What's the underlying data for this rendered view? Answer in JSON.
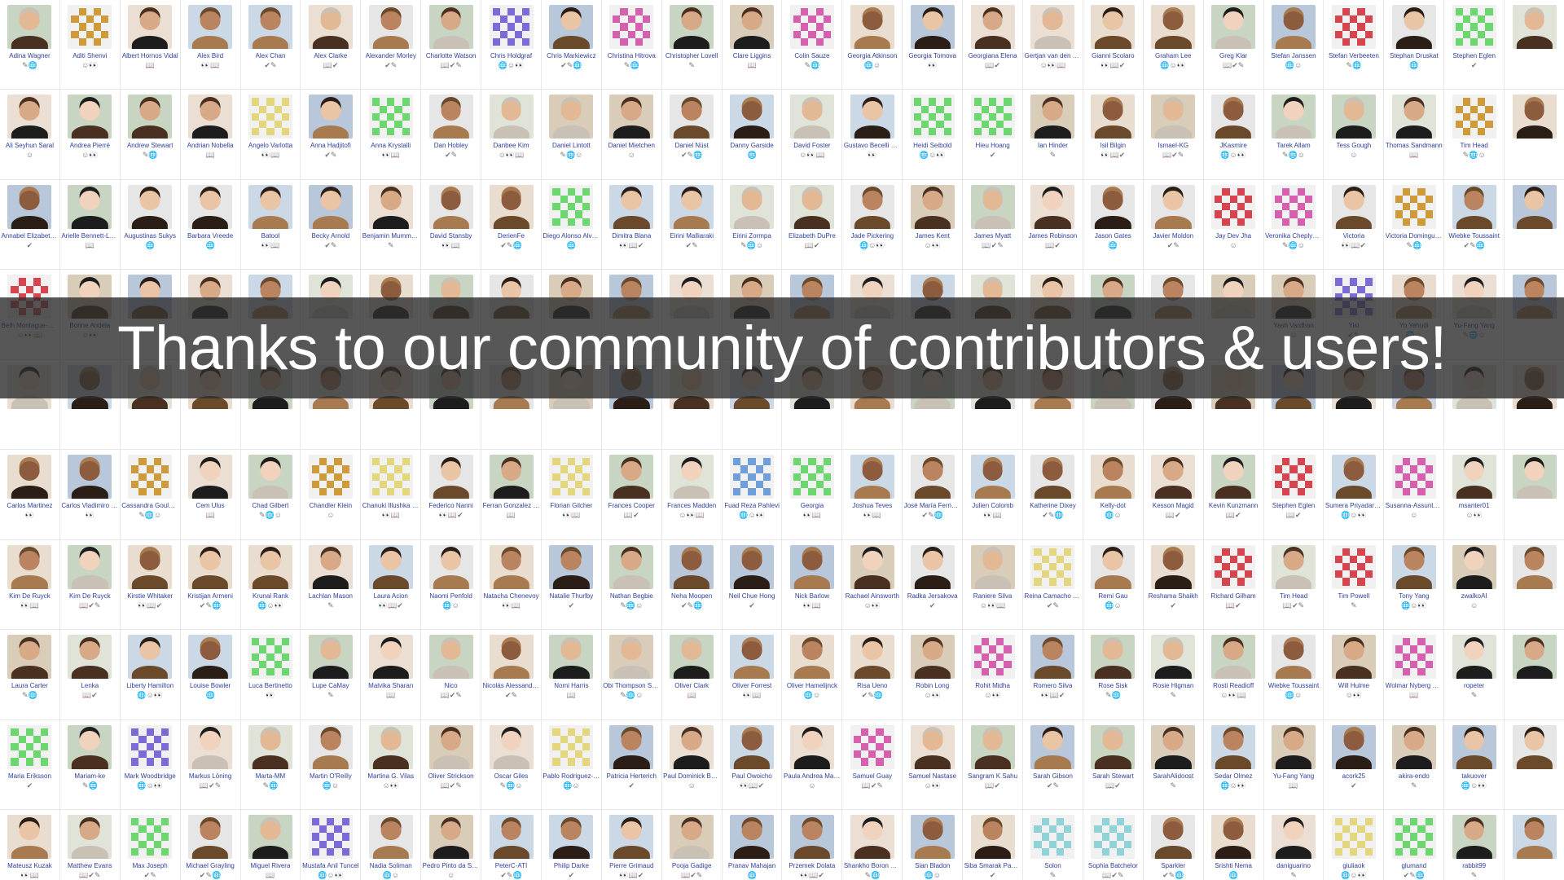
{
  "banner": {
    "text": "Thanks to our community of contributors & users!"
  },
  "colors": {
    "banner_overlay": "#2d2d2d",
    "banner_text": "#ffffff",
    "name_text": "#2f3f99",
    "identicon_palette": [
      "#7d6ad6",
      "#d65fb0",
      "#6cd66f",
      "#cf9b3a",
      "#6f9fdb",
      "#d6454e",
      "#e4d67d",
      "#8fd3d9"
    ]
  },
  "badge_icons": [
    "pencil-icon",
    "globe-icon",
    "smiley-icon",
    "eyes-icon",
    "book-icon",
    "check-icon"
  ],
  "contributors": [
    "Adina Wagner",
    "Aditi Shenvi",
    "Albert Hornos Vidal",
    "Alex Bird",
    "Alex Chan",
    "Alex Clarke",
    "Alexander Morley",
    "Charlotte Watson",
    "Chris Holdgraf",
    "Chris Markiewicz",
    "Christina Hitrova",
    "Christopher Lovell",
    "Clare Liggins",
    "Colin Sauze",
    "Georgia Atkinson",
    "Georgia Tomova",
    "Georgiana Elena",
    "Gertjan van den Burg",
    "Gianni Scolaro",
    "Graham Lee",
    "Greg Klar",
    "Stefan Janssen",
    "Stefan Verbeeten",
    "Stephan Druskat",
    "Stephen Eglen",
    "",
    "Ali Seyhun Saral",
    "Andrea Pierré",
    "Andrew Stewart",
    "Andrian Nobella",
    "Angelo Varlotta",
    "Anna Hadjitofi",
    "Anna Krystalli",
    "Dan Hobley",
    "Danbee Kim",
    "Daniel Lintott",
    "Daniel Mietchen",
    "Daniel Nüst",
    "Danny Garside",
    "David Foster",
    "Gustavo Becelli do Nacimento",
    "Heidi Seibold",
    "Hieu Hoang",
    "Ian Hinder",
    "Isil Bilgin",
    "Ismael-KG",
    "JKasmire",
    "Tarek Allam",
    "Tess Gough",
    "Thomas Sandmann",
    "Tim Head",
    "",
    "Annabel Elizabeth Whipp",
    "Arielle Bennett-Lovell",
    "Augustinas Sukys",
    "Barbara Vreede",
    "Batool",
    "Becky Arnold",
    "Benjamin Mummery",
    "David Stansby",
    "DerienFe",
    "Diego Alonso Alvarez",
    "Dimitra Blana",
    "Eirini Malliaraki",
    "Eirini Zormpa",
    "Elizabeth DuPre",
    "Jade Pickering",
    "James Kent",
    "James Myatt",
    "James Robinson",
    "Jason Gates",
    "Javier Moldon",
    "Jay Dev Jha",
    "Veronika Cheplygina",
    "Victoria",
    "Victoria Dominguez del Angel",
    "Wiebke Toussaint",
    "",
    "Beth Montague-Hellen",
    "Bonne Andela",
    "",
    "",
    "",
    "",
    "",
    "",
    "",
    "",
    "",
    "",
    "",
    "",
    "",
    "",
    "",
    "",
    "",
    "",
    "",
    "Yash Vardhan",
    "Yixi",
    "Yo Yehudi",
    "Yu-Fang Yang",
    "",
    "",
    "",
    "",
    "",
    "",
    "",
    "",
    "",
    "",
    "",
    "",
    "",
    "",
    "",
    "",
    "",
    "",
    "",
    "",
    "",
    "",
    "",
    "",
    "",
    "",
    "",
    "Carlos Martinez",
    "Carlos Vladimiro González Zelaya",
    "Cassandra Gould van Praag",
    "Cem Ulus",
    "Chad Gilbert",
    "Chandler Klein",
    "Chanuki Illushka Seresinhe",
    "Federico Nanni",
    "Ferran Gonzalez Hernandez",
    "Florian Gilcher",
    "Frances Cooper",
    "Frances Madden",
    "Fuad Reza Pahlevi",
    "Georgia",
    "Joshua Teves",
    "José María Fernández",
    "Julien Colomb",
    "Katherine Dixey",
    "Kelly-dot",
    "Kesson Magid",
    "Kevin Kunzmann",
    "Stephen Eglen",
    "Sumera Priyadarsini",
    "Susanna-Assunta Sansone",
    "msanter01",
    "",
    "Kim De Ruyck",
    "Kim De Ruyck",
    "Kirstie Whitaker",
    "Kristijan Armeni",
    "Krunal Rank",
    "Lachlan Mason",
    "Laura Acion",
    "Naomi Penfold",
    "Natacha Chenevoy",
    "Natalie Thurlby",
    "Nathan Begbie",
    "Neha Moopen",
    "Neil Chue Hong",
    "Nick Barlow",
    "Rachael Ainsworth",
    "Radka Jersakova",
    "Raniere Silva",
    "Reina Camacho Toro",
    "Remi Gau",
    "Reshama Shaikh",
    "Richard Gilham",
    "Tim Head",
    "Tim Powell",
    "Tony Yang",
    "zwalkoAI",
    "",
    "Laura Carter",
    "Lenka",
    "Liberty Hamilton",
    "Louise Bowler",
    "Luca Bertinetto",
    "Lupe CaMay",
    "Malvika Sharan",
    "Nico",
    "Nicolás Alessandroni",
    "Nomi Harris",
    "Obi Thompson Sargoni",
    "Oliver Clark",
    "Oliver Forrest",
    "Oliver Hamelijnck",
    "Risa Ueno",
    "Robin Long",
    "Rohit Midha",
    "Romero Silva",
    "Rose Sisk",
    "Rosie Higman",
    "Rosti Readioff",
    "Wiebke Toussaint",
    "Will Hulme",
    "Wolmar Nyberg Åkerström",
    "ropeter",
    "",
    "Maria Eriksson",
    "Mariam-ke",
    "Mark Woodbridge",
    "Markus Löning",
    "Marta-MM",
    "Martin O'Reilly",
    "Martina G. Vilas",
    "Oliver Strickson",
    "Oscar Giles",
    "Pablo Rodriguez-Sánchez",
    "Patricia Herterich",
    "Paul Dominick Baniqued",
    "Paul Owoicho",
    "Paula Andrea Martinez",
    "Samuel Guay",
    "Samuel Nastase",
    "Sangram K Sahu",
    "Sarah Gibson",
    "Sarah Stewart",
    "SarahAlidoost",
    "Sedar Olmez",
    "Yu-Fang Yang",
    "acork25",
    "akira-endo",
    "takuover",
    ""
  ],
  "last_row": [
    "Mateusz Kuzak",
    "Matthew Evans",
    "Max Joseph",
    "Michael Grayling",
    "Miguel Rivera",
    "Mustafa Anil Tuncel",
    "Nadia Soliman",
    "Pedro Pinto da Silva",
    "PeterC-ATI",
    "Philip Darke",
    "Pierre Grimaud",
    "Pooja Gadige",
    "Pranav Mahajan",
    "Przemek Dolata",
    "Shankho Boron Ghosh",
    "Sian Bladon",
    "Siba Smarak Panigrahi",
    "Solon",
    "Sophia Batchelor",
    "Sparkler",
    "Srishti Nema",
    "daniguarino",
    "giuliaok",
    "glumand",
    "rabbit99",
    ""
  ]
}
